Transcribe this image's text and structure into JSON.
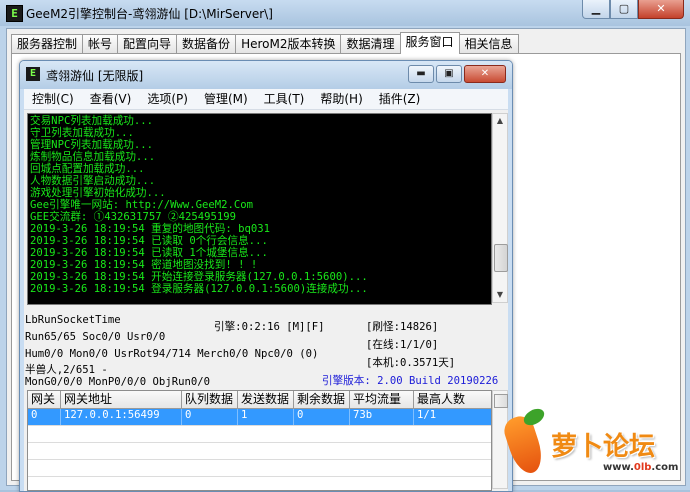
{
  "window": {
    "title": "GeeM2引擎控制台-鸢翎游仙 [D:\\MirServer\\]",
    "minimize": "▁",
    "maximize": "▢",
    "close": "✕"
  },
  "tabs": [
    {
      "label": "服务器控制"
    },
    {
      "label": "帐号"
    },
    {
      "label": "配置向导"
    },
    {
      "label": "数据备份"
    },
    {
      "label": "HeroM2版本转换"
    },
    {
      "label": "数据清理"
    },
    {
      "label": "服务窗口",
      "selected": true
    },
    {
      "label": "相关信息"
    }
  ],
  "inner_window": {
    "icon_text": "E",
    "title": "鸢翎游仙 [无限版]",
    "minimize": "▬",
    "maximize": "▣",
    "close": "✕"
  },
  "menu": [
    "控制(C)",
    "查看(V)",
    "选项(P)",
    "管理(M)",
    "工具(T)",
    "帮助(H)",
    "插件(Z)"
  ],
  "console_lines": [
    "交易NPC列表加载成功...",
    "守卫列表加载成功...",
    "管理NPC列表加载成功...",
    "炼制物品信息加载成功...",
    "回城点配置加载成功...",
    "人物数据引擎启动成功...",
    "游戏处理引擎初始化成功...",
    "Gee引擎唯一网站: http://Www.GeeM2.Com",
    "GEE交流群: ①432631757   ②425495199",
    "2019-3-26 18:19:54 重复的地图代码: bq031",
    "2019-3-26 18:19:54 已读取 0个行会信息...",
    "2019-3-26 18:19:54 已读取 1个城堡信息...",
    "2019-3-26 18:19:54 密道地图没找到! ! !",
    "2019-3-26 18:19:54 开始连接登录服务器(127.0.0.1:5600)...",
    "2019-3-26 18:19:54 登录服务器(127.0.0.1:5600)连接成功..."
  ],
  "status": {
    "run_socket_time": "LbRunSocketTime",
    "engine": "引擎:0:2:16 [M][F]",
    "refresh_monster": "[刷怪:14826]",
    "run": "Run65/65 Soc0/0 Usr0/0",
    "online": "[在线:1/1/0]",
    "hum": "Hum0/0 Mon0/0 UsrRot94/714 Merch0/0 Npc0/0 (0)",
    "local": "[本机:0.3571天]",
    "half_beast": "半兽人,2/651 -",
    "mon": "MonG0/0/0 MonP0/0/0 ObjRun0/0",
    "version": "引擎版本: 2.00 Build 20190226"
  },
  "grid": {
    "columns": [
      "网关",
      "网关地址",
      "队列数据",
      "发送数据",
      "剩余数据",
      "平均流量",
      "最高人数"
    ],
    "rows": [
      [
        "0",
        "127.0.0.1:56499",
        "0",
        "1",
        "0",
        "73b",
        "1/1"
      ]
    ]
  },
  "watermark": {
    "brand": "萝卜论坛",
    "url_prefix": "www.",
    "url_mid": "0lb",
    "url_suffix": ".com"
  },
  "colors": {
    "console_text": "#19e81a",
    "console_bg": "#000000",
    "selection": "#3399ff",
    "version_text": "#1b1bd8"
  }
}
